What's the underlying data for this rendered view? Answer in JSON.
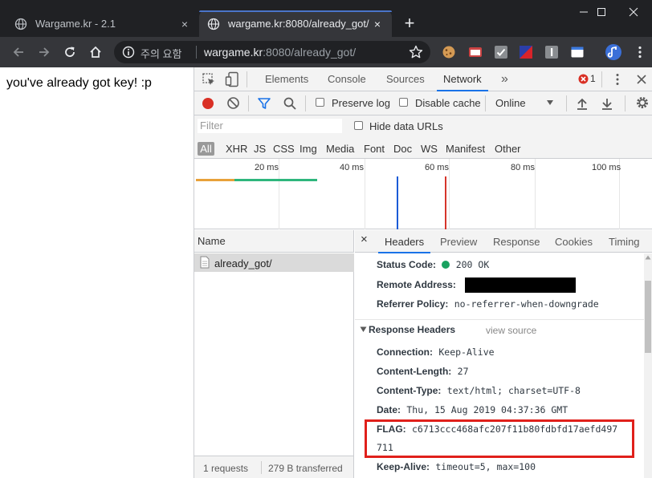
{
  "browser": {
    "tabs": [
      {
        "title": "Wargame.kr - 2.1",
        "active": false
      },
      {
        "title": "wargame.kr:8080/already_got/",
        "active": true
      }
    ],
    "new_tab_symbol": "+",
    "tab_close_symbol": "×",
    "window_controls": {
      "minimize": "—",
      "maximize": "☐",
      "close": "✕"
    },
    "omnibox": {
      "security_label": "주의 요함",
      "url_host": "wargame.kr",
      "url_rest": ":8080/already_got/"
    },
    "icons": [
      "back-icon",
      "forward-icon",
      "reload-icon",
      "home-icon",
      "info-icon",
      "star-icon",
      "cookie-extension-icon",
      "extension-icon",
      "profile-avatar",
      "menu-icon"
    ]
  },
  "page": {
    "text": "you've already got key! :p"
  },
  "devtools": {
    "panels": [
      "Elements",
      "Console",
      "Sources",
      "Network"
    ],
    "active_panel": "Network",
    "more_symbol": "»",
    "error_count": "1",
    "toolbar": {
      "preserve_log": "Preserve log",
      "disable_cache": "Disable cache",
      "throttle": "Online"
    },
    "filter": {
      "placeholder": "Filter",
      "hide_data_urls": "Hide data URLs",
      "types": [
        "All",
        "XHR",
        "JS",
        "CSS",
        "Img",
        "Media",
        "Font",
        "Doc",
        "WS",
        "Manifest",
        "Other"
      ]
    },
    "overview": {
      "ticks": [
        "20 ms",
        "40 ms",
        "60 ms",
        "80 ms",
        "100 ms"
      ],
      "colors": {
        "waiting": "#e8a13a",
        "download": "#2eb67d",
        "dom_content_loaded": "#1a5bd6",
        "load": "#d6352b"
      }
    },
    "requests": {
      "column_name": "Name",
      "rows": [
        {
          "name": "already_got/"
        }
      ],
      "status": {
        "count": "1 requests",
        "transferred": "279 B transferred"
      }
    },
    "detail": {
      "close_symbol": "×",
      "tabs": [
        "Headers",
        "Preview",
        "Response",
        "Cookies",
        "Timing"
      ],
      "active_tab": "Headers",
      "general": [
        {
          "key": "Status Code:",
          "value": "200 OK",
          "status_color": "#1aa260"
        },
        {
          "key": "Remote Address:",
          "value": ""
        },
        {
          "key": "Referrer Policy:",
          "value": "no-referrer-when-downgrade"
        }
      ],
      "response_headers_title": "Response Headers",
      "view_source": "view source",
      "response_headers": [
        {
          "key": "Connection:",
          "value": "Keep-Alive"
        },
        {
          "key": "Content-Length:",
          "value": "27"
        },
        {
          "key": "Content-Type:",
          "value": "text/html; charset=UTF-8"
        },
        {
          "key": "Date:",
          "value": "Thu, 15 Aug 2019 04:37:36 GMT"
        },
        {
          "key": "FLAG:",
          "value": "c6713ccc468afc207f11b80fdbfd17aefd497",
          "value_cont": "711"
        },
        {
          "key": "Keep-Alive:",
          "value": "timeout=5, max=100"
        }
      ],
      "highlight_color": "#e0201b"
    }
  }
}
